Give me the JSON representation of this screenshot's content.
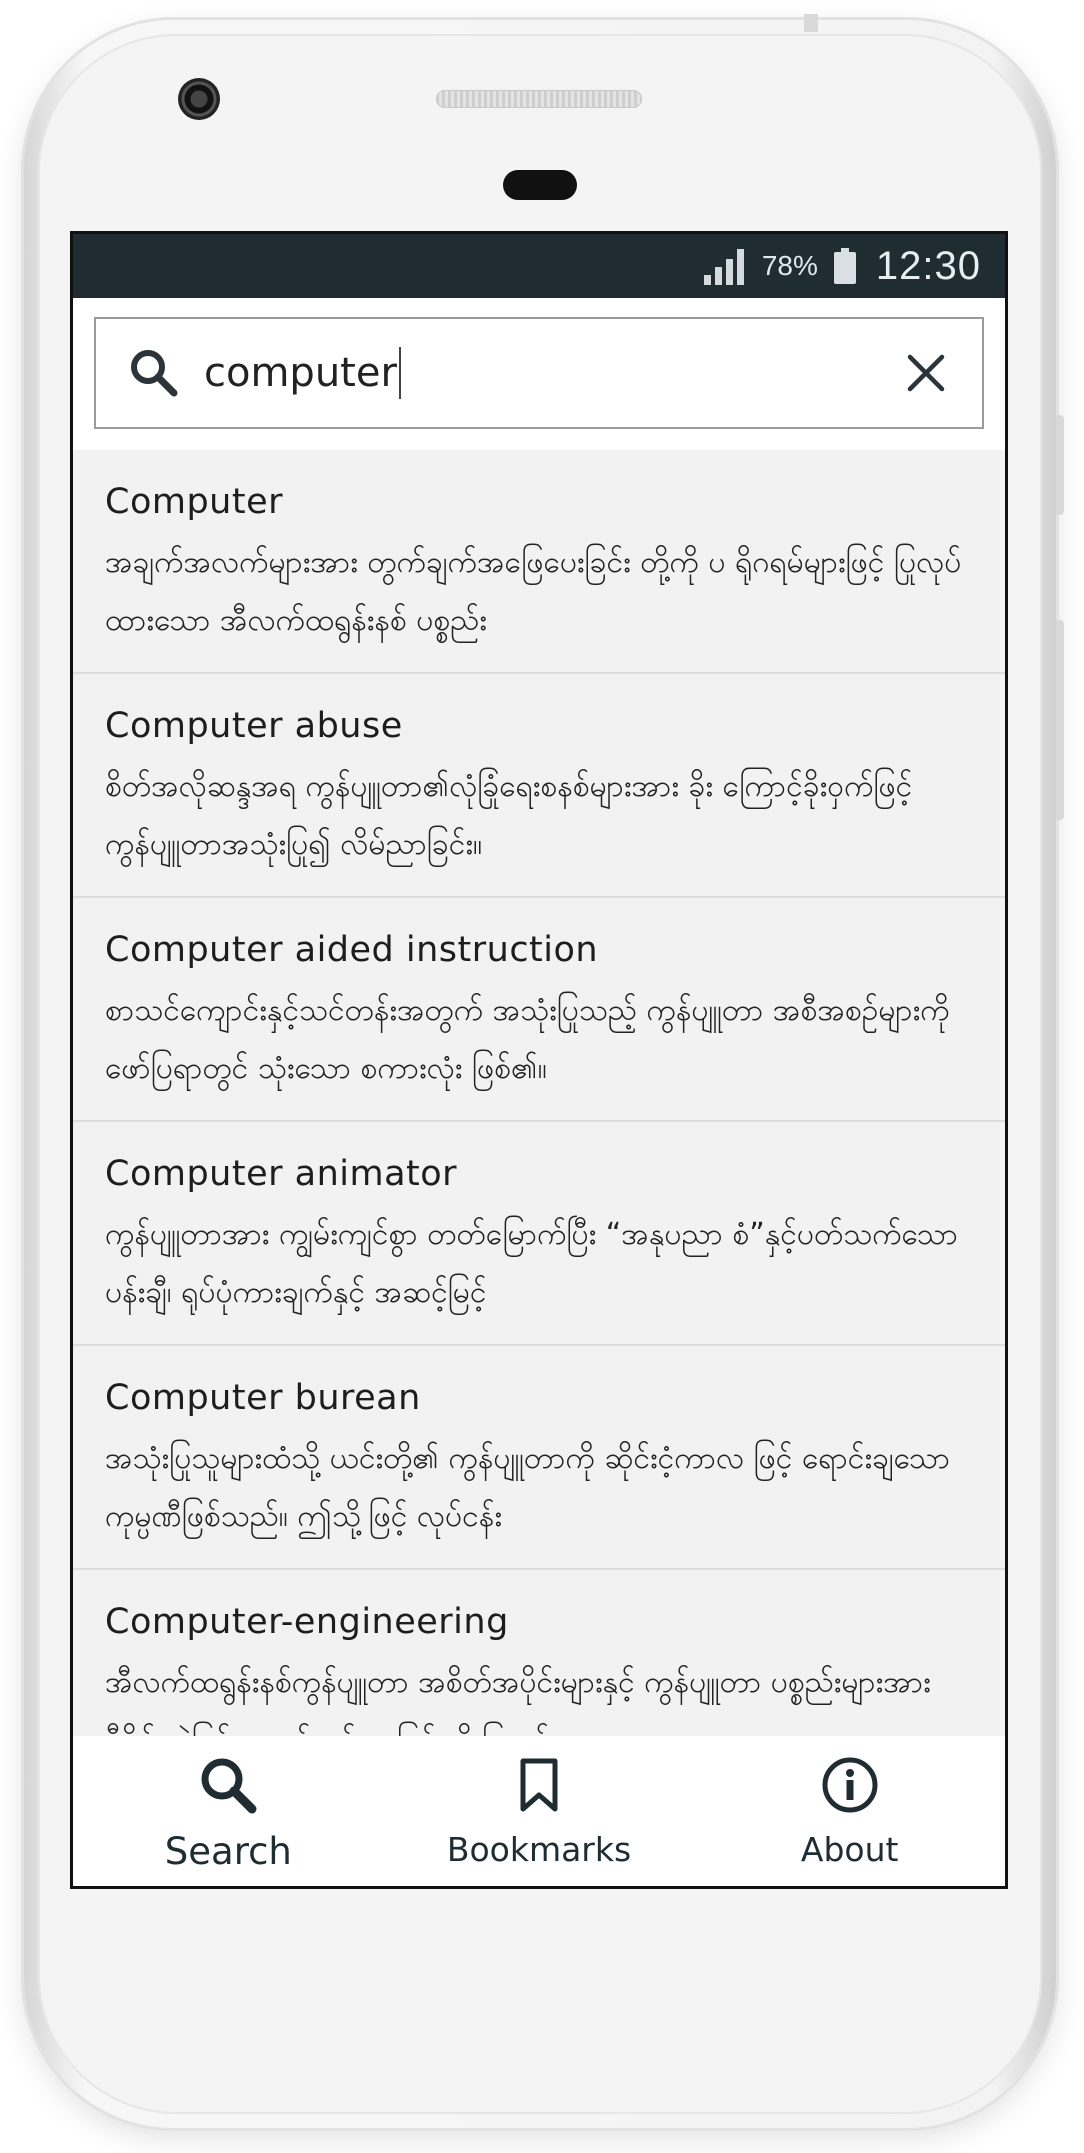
{
  "statusbar": {
    "battery_percent": "78%",
    "time": "12:30",
    "signal_icon": "cell-signal-icon",
    "battery_icon": "battery-icon"
  },
  "search": {
    "query": "computer",
    "icon": "search-icon",
    "clear_icon": "close-icon"
  },
  "results": [
    {
      "word": "Computer",
      "definition": "အချက်အလက်များအား တွက်ချက်အဖြေပေးခြင်း တို့ကို ပ ရိုဂရမ်များဖြင့် ပြုလုပ်ထားသော အီလက်ထရွန်းနစ် ပစ္စည်း"
    },
    {
      "word": "Computer abuse",
      "definition": "စိတ်အလိုဆန္ဒအရ ကွန်ပျူတာ၏လုံခြုံရေးစနစ်များအား ခိုး ကြောင့်ခိုးဝှက်ဖြင့် ကွန်ပျူတာအသုံးပြု၍ လိမ်ညာခြင်း။"
    },
    {
      "word": "Computer aided instruction",
      "definition": "စာသင်ကျောင်းနှင့်သင်တန်းအတွက် အသုံးပြုသည့် ကွန်ပျူတာ အစီအစဉ်များကို ဖော်ပြရာတွင် သုံးသော စကားလုံး ဖြစ်၏။"
    },
    {
      "word": "Computer animator",
      "definition": "ကွန်ပျူတာအား ကျွမ်းကျင်စွာ တတ်မြောက်ပြီး “အနုပညာ စံ”နှင့်ပတ်သက်သော ပန်းချီ၊ ရုပ်ပုံကားချက်နှင့် အဆင့်မြင့်"
    },
    {
      "word": "Computer burean",
      "definition": "အသုံးပြုသူများထံသို့ ယင်းတို့၏ ကွန်ပျူတာကို ဆိုင်းငံ့ကာလ ဖြင့် ရောင်းချသော ကုမ္ပဏီဖြစ်သည်။ ဤသို့ဖြင့် လုပ်ငန်း"
    },
    {
      "word": "Computer-engineering",
      "definition": "အီလက်ထရွန်းနစ်ကွန်ပျူတာ အစိတ်အပိုင်းများနှင့် ကွန်ပျူတာ ပစ္စည်းများအား ဒီဇိုင်းဆွဲခြင်း၊ တက်လုပ်ပေးခြင်းကို ပြုလုပ်ပေး"
    }
  ],
  "nav": {
    "search_label": "Search",
    "bookmarks_label": "Bookmarks",
    "about_label": "About"
  }
}
